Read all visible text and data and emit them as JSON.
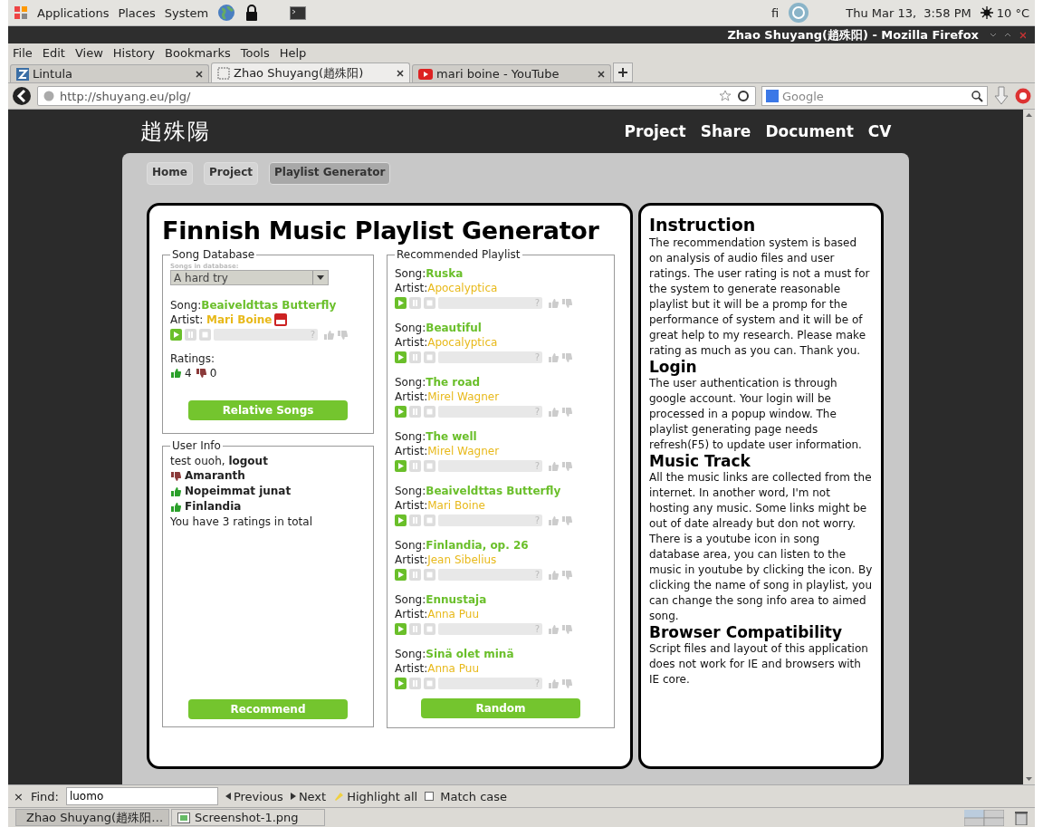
{
  "top_panel": {
    "menus": [
      "Applications",
      "Places",
      "System"
    ],
    "keyboard": "fi",
    "clock": "Thu Mar 13,  3:58 PM",
    "weather": "10 °C"
  },
  "window": {
    "title": "Zhao Shuyang(趙殊阳) - Mozilla Firefox"
  },
  "menu_bar": [
    "File",
    "Edit",
    "View",
    "History",
    "Bookmarks",
    "Tools",
    "Help"
  ],
  "tabs": [
    {
      "label": "Lintula",
      "selected": false,
      "kind": "lintula"
    },
    {
      "label": "Zhao Shuyang(趙殊阳)",
      "selected": true,
      "kind": "blank"
    },
    {
      "label": "mari boine - YouTube",
      "selected": false,
      "kind": "youtube"
    }
  ],
  "address": {
    "value": "http://shuyang.eu/plg/"
  },
  "search": {
    "placeholder": "Google"
  },
  "site": {
    "logo": "趙殊陽",
    "nav": [
      "Project",
      "Share",
      "Document",
      "CV"
    ],
    "breadcrumbs": [
      {
        "label": "Home",
        "selected": false
      },
      {
        "label": "Project",
        "selected": false
      },
      {
        "label": "Playlist Generator",
        "selected": true
      }
    ]
  },
  "title": "Finnish Music Playlist Generator",
  "song_database": {
    "legend": "Song Database",
    "select_label": "Songs in database:",
    "select_value": "A hard try",
    "song_label": "Song:",
    "song": "Beaiveldttas Butterfly",
    "artist_label": "Artist:",
    "artist": "Mari Boine",
    "time": "?",
    "ratings_label": "Ratings:",
    "likes": "4",
    "dislikes": "0",
    "button": "Relative Songs"
  },
  "user_info": {
    "legend": "User Info",
    "user": "test ouoh,",
    "logout": "logout",
    "ratings": [
      {
        "song": "Amaranth",
        "liked": false
      },
      {
        "song": "Nopeimmat junat",
        "liked": true
      },
      {
        "song": "Finlandia",
        "liked": true
      }
    ],
    "summary": "You have 3 ratings in total",
    "button": "Recommend"
  },
  "playlist": {
    "legend": "Recommended Playlist",
    "songs": [
      {
        "song_label": "Song:",
        "song": "Ruska",
        "artist_label": "Artist:",
        "artist": "Apocalyptica",
        "time": "?"
      },
      {
        "song_label": "Song:",
        "song": "Beautiful",
        "artist_label": "Artist:",
        "artist": "Apocalyptica",
        "time": "?"
      },
      {
        "song_label": "Song:",
        "song": "The road",
        "artist_label": "Artist:",
        "artist": "Mirel Wagner",
        "time": "?"
      },
      {
        "song_label": "Song:",
        "song": "The well",
        "artist_label": "Artist:",
        "artist": "Mirel Wagner",
        "time": "?"
      },
      {
        "song_label": "Song:",
        "song": "Beaiveldttas Butterfly",
        "artist_label": "Artist:",
        "artist": "Mari Boine",
        "time": "?"
      },
      {
        "song_label": "Song:",
        "song": "Finlandia, op. 26",
        "artist_label": "Artist:",
        "artist": "Jean Sibelius",
        "time": "?"
      },
      {
        "song_label": "Song:",
        "song": "Ennustaja",
        "artist_label": "Artist:",
        "artist": "Anna Puu",
        "time": "?"
      },
      {
        "song_label": "Song:",
        "song": "Sinä olet minä",
        "artist_label": "Artist:",
        "artist": "Anna Puu",
        "time": "?"
      }
    ],
    "button": "Random"
  },
  "instructions": [
    {
      "heading": "Instruction",
      "text": "The recommendation system is based on analysis of audio files and user ratings. The user rating is not a must for the system to generate reasonable playlist but it will be a promp for the performance of system and it will be of great help to my research. Please make rating as much as you can. Thank you."
    },
    {
      "heading": "Login",
      "text": "The user authentication is through google account. Your login will be processed in a popup window. The playlist generating page needs refresh(F5) to update user information."
    },
    {
      "heading": "Music Track",
      "text": "All the music links are collected from the internet. In another word, I'm not hosting any music. Some links might be out of date already but don not worry. There is a youtube icon in song database area, you can listen to the music in youtube by clicking the icon. By clicking the name of song in playlist, you can change the song info area to aimed song."
    },
    {
      "heading": "Browser Compatibility",
      "text": "Script files and layout of this application does not work for IE and browsers with IE core."
    }
  ],
  "find_bar": {
    "close": "×",
    "label": "Find:",
    "value": "luomo",
    "previous": "Previous",
    "next": "Next",
    "highlight": "Highlight all",
    "match_case": {
      "label": "Match case",
      "checked": false
    }
  },
  "taskbar": [
    {
      "label": "Zhao Shuyang(趙殊阳…",
      "kind": "firefox",
      "selected": true
    },
    {
      "label": "Screenshot-1.png",
      "kind": "image",
      "selected": false
    }
  ]
}
